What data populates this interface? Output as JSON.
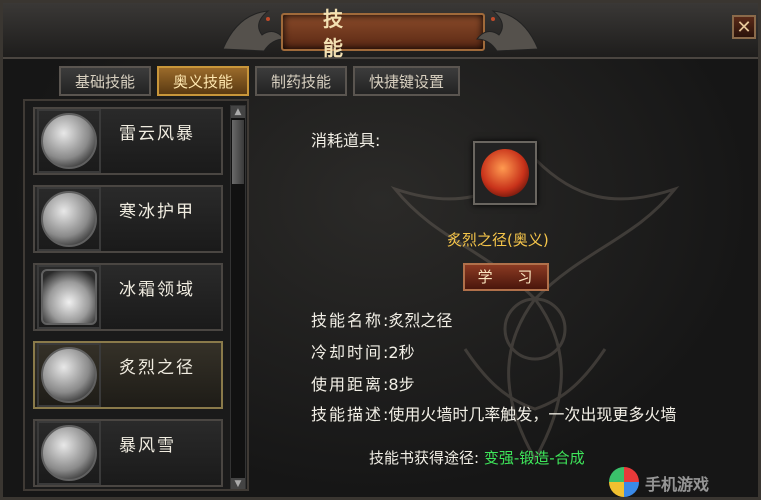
{
  "window": {
    "title": "技 能",
    "close_symbol": "✕",
    "colors": {
      "accent": "#c8963a",
      "highlight_text": "#f5c54a",
      "source_green": "#3ee65a"
    }
  },
  "tabs": [
    {
      "label": "基础技能",
      "active": false
    },
    {
      "label": "奥义技能",
      "active": true
    },
    {
      "label": "制药技能",
      "active": false
    },
    {
      "label": "快捷键设置",
      "active": false
    }
  ],
  "skills": [
    {
      "name": "雷云风暴",
      "icon": "lightning-orb-icon",
      "selected": false
    },
    {
      "name": "寒冰护甲",
      "icon": "ice-armor-orb-icon",
      "selected": false
    },
    {
      "name": "冰霜领域",
      "icon": "frost-field-icon",
      "selected": false
    },
    {
      "name": "炙烈之径",
      "icon": "flame-path-orb-icon",
      "selected": true
    },
    {
      "name": "暴风雪",
      "icon": "blizzard-orb-icon",
      "selected": false
    }
  ],
  "detail": {
    "consume_label": "消耗道具:",
    "item_icon": "fire-orb-icon",
    "item_name": "炙烈之径(奥义)",
    "learn_button": "学 习",
    "rows": [
      {
        "key": "技能名称",
        "value": ":炙烈之径"
      },
      {
        "key": "冷却时间",
        "value": ":2秒"
      },
      {
        "key": "使用距离",
        "value": ":8步"
      },
      {
        "key": "技能描述",
        "value": ":使用火墙时几率触发，一次出现更多火墙"
      }
    ],
    "source_label": "技能书获得途径: ",
    "source_value": "变强-锻造-合成"
  },
  "watermark": {
    "text": "手机游戏"
  }
}
